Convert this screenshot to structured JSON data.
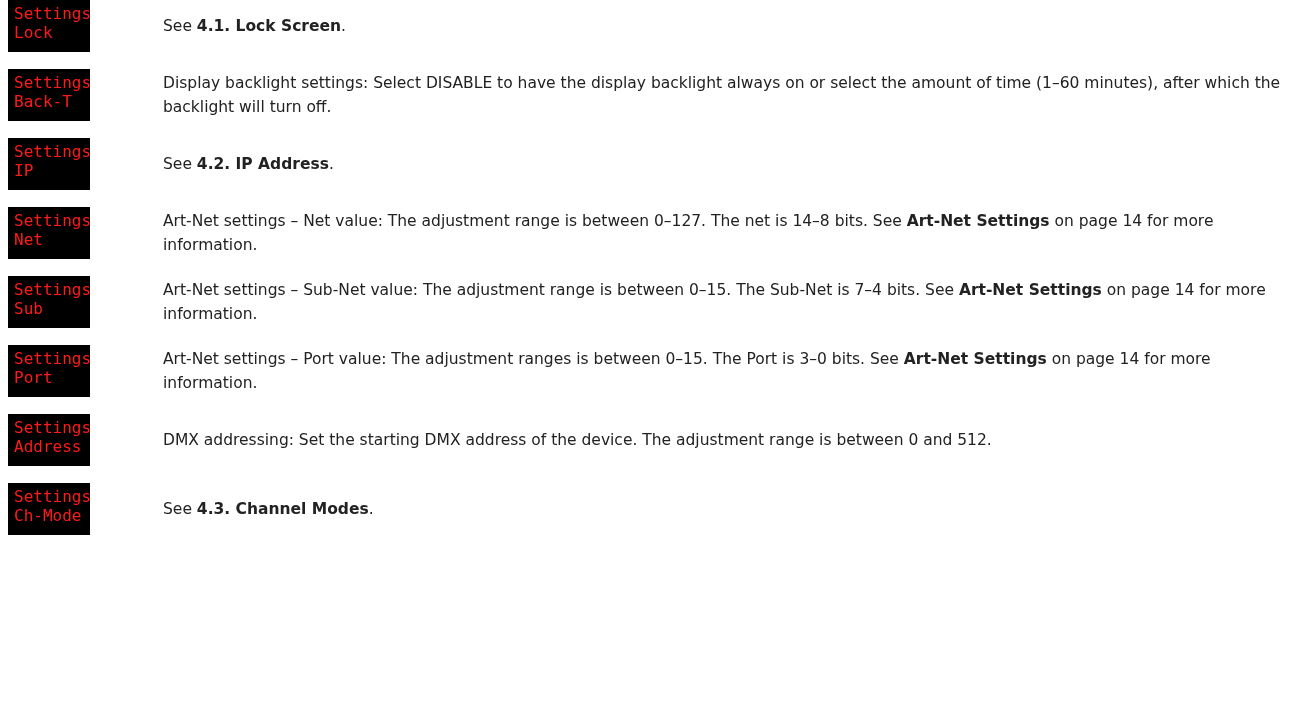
{
  "rows": [
    {
      "display": [
        "Settings",
        "Lock"
      ],
      "description": "See **4.1. Lock Screen**."
    },
    {
      "display": [
        "Settings",
        "Back-T"
      ],
      "description": "Display backlight settings: Select DISABLE to have the display backlight always on or select the amount of time (1–60 minutes), after which the backlight will turn off."
    },
    {
      "display": [
        "Settings",
        "IP"
      ],
      "description": "See **4.2. IP Address**."
    },
    {
      "display": [
        "Settings",
        "Net"
      ],
      "description": "Art-Net settings – Net value: The adjustment range is between 0–127. The net is 14–8 bits. See **Art-Net Settings** on page 14 for more information."
    },
    {
      "display": [
        "Settings",
        "Sub"
      ],
      "description": "Art-Net settings – Sub-Net value: The adjustment range is between 0–15. The Sub-Net is 7–4 bits. See **Art-Net Settings** on page 14 for more information."
    },
    {
      "display": [
        "Settings",
        "Port"
      ],
      "description": "Art-Net settings – Port value: The adjustment ranges is between 0–15. The Port is 3–0 bits. See **Art-Net Settings** on page 14 for more information."
    },
    {
      "display": [
        "Settings",
        "Address"
      ],
      "description": "DMX addressing: Set the starting DMX address of the device. The adjustment range is between 0 and 512."
    },
    {
      "display": [
        "Settings",
        "Ch-Mode"
      ],
      "description": "See **4.3. Channel Modes**."
    }
  ]
}
